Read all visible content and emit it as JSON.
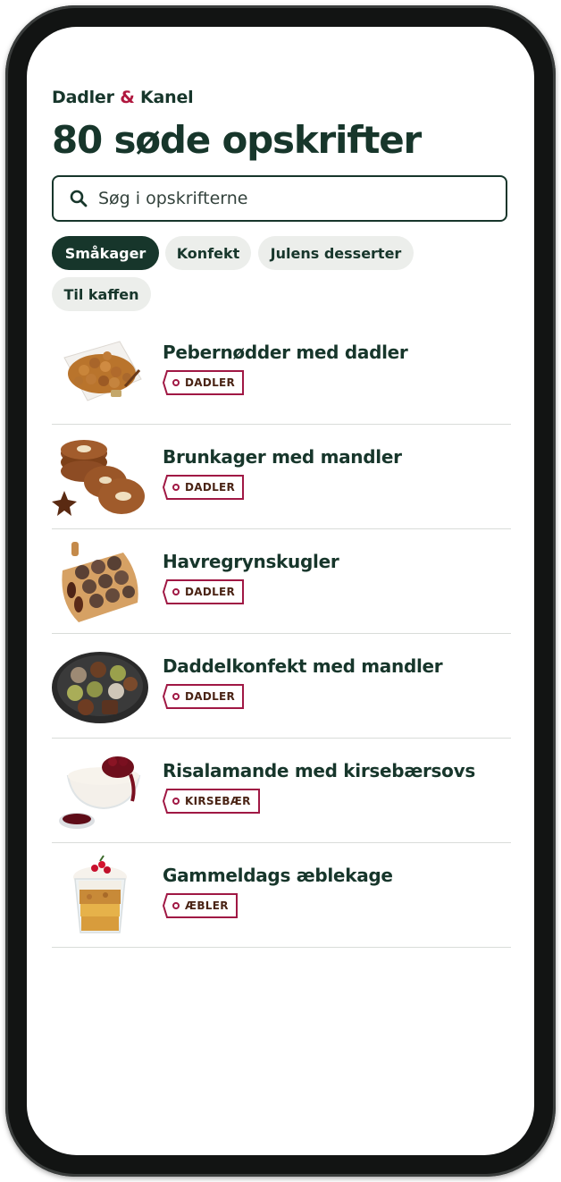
{
  "brand": {
    "part1": "Dadler",
    "amp": "&",
    "part2": "Kanel"
  },
  "page_title": "80 søde opskrifter",
  "search": {
    "placeholder": "Søg i opskrifterne",
    "icon": "search-icon"
  },
  "filters": [
    {
      "label": "Småkager",
      "active": true
    },
    {
      "label": "Konfekt",
      "active": false
    },
    {
      "label": "Julens desserter",
      "active": false
    },
    {
      "label": "Til kaffen",
      "active": false
    }
  ],
  "recipes": [
    {
      "name": "Pebernødder med dadler",
      "tag": "DADLER",
      "image": "pebernodder-image"
    },
    {
      "name": "Brunkager med mandler",
      "tag": "DADLER",
      "image": "brunkager-image"
    },
    {
      "name": "Havregrynskugler",
      "tag": "DADLER",
      "image": "havregrynskugler-image"
    },
    {
      "name": "Daddelkonfekt med mandler",
      "tag": "DADLER",
      "image": "daddelkonfekt-image"
    },
    {
      "name": "Risalamande med kirsebærsovs",
      "tag": "KIRSEBÆR",
      "image": "risalamande-image"
    },
    {
      "name": "Gammeldags æblekage",
      "tag": "ÆBLER",
      "image": "aeblekage-image"
    }
  ],
  "colors": {
    "primary": "#17362b",
    "accent": "#b0173e",
    "tag_border": "#a01844",
    "chip_bg": "#eceeeb"
  }
}
